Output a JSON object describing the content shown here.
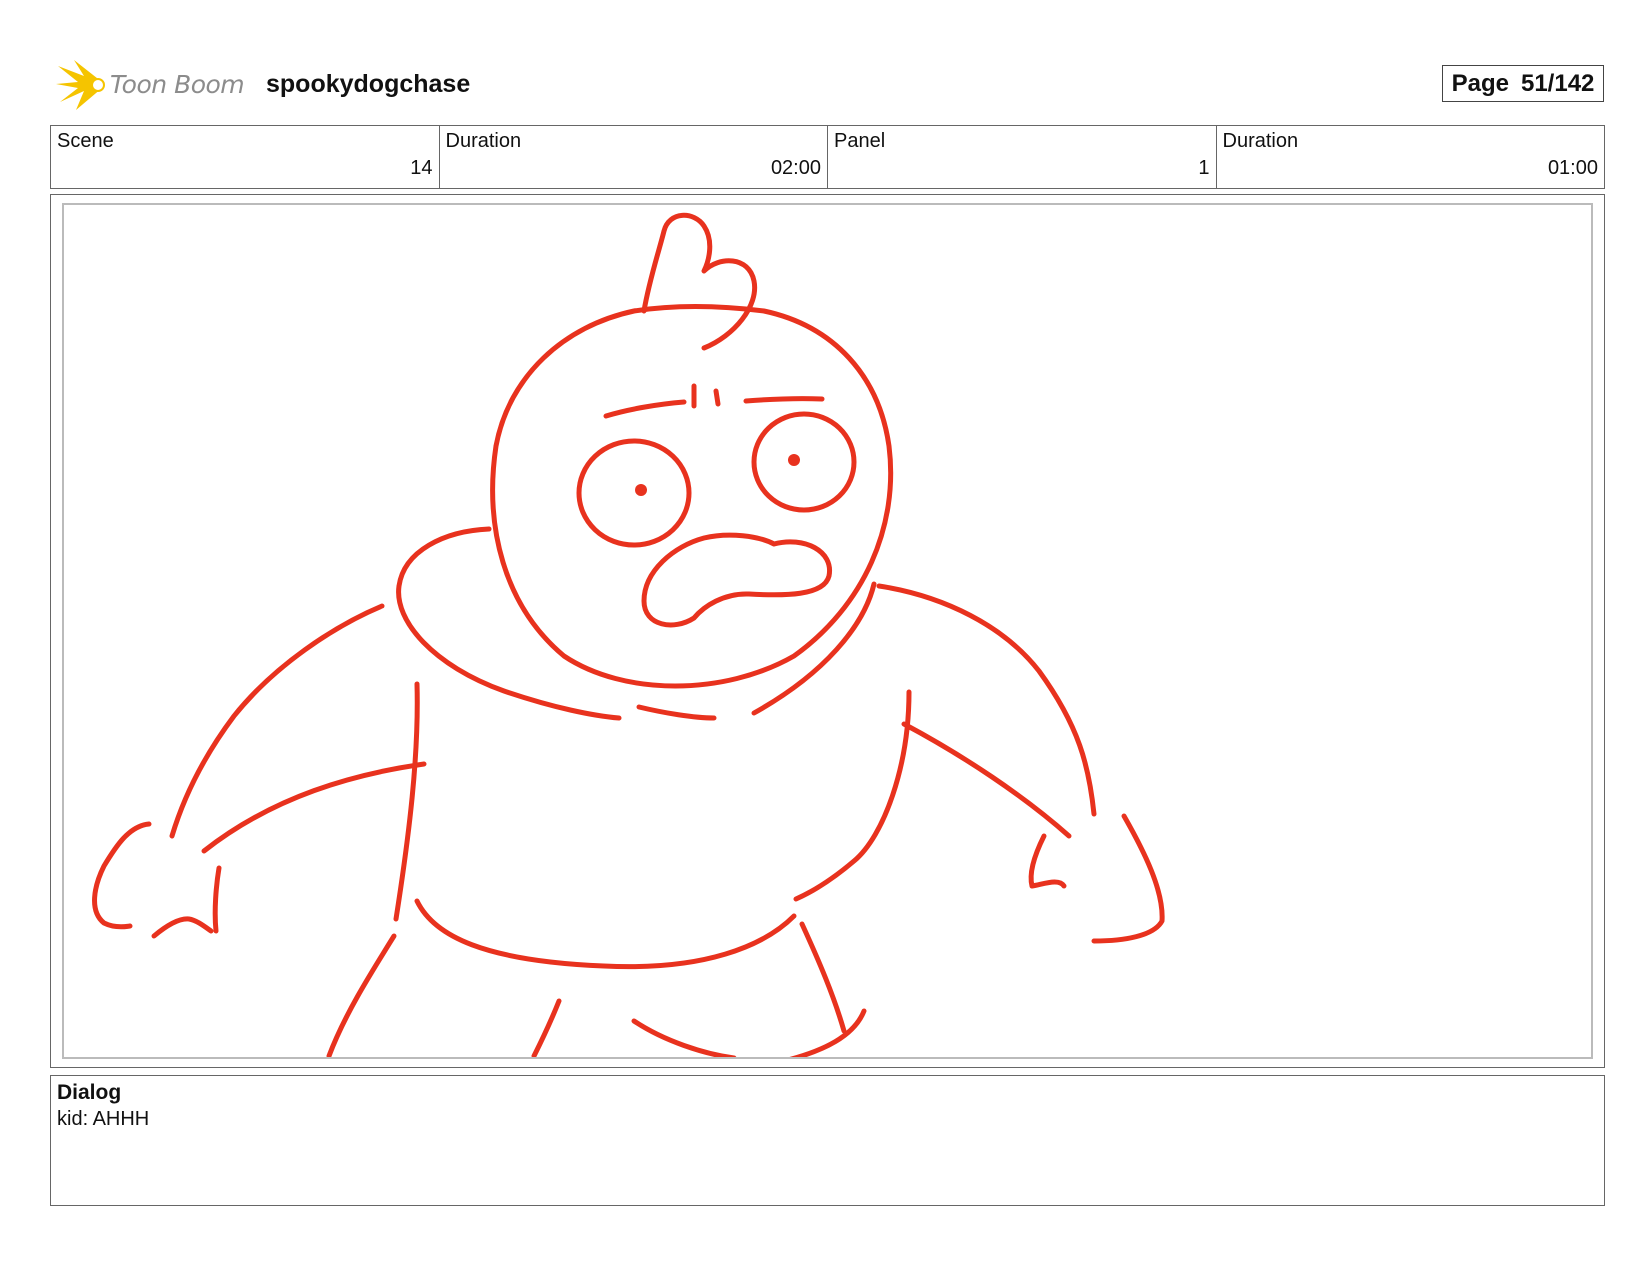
{
  "header": {
    "logo_text": "Toon Boom",
    "project_title": "spookydogchase",
    "page_label": "Page",
    "page_value": "51/142"
  },
  "info": [
    {
      "label": "Scene",
      "value": "14"
    },
    {
      "label": "Duration",
      "value": "02:00"
    },
    {
      "label": "Panel",
      "value": "1"
    },
    {
      "label": "Duration",
      "value": "01:00"
    }
  ],
  "panel": {
    "sketch_color": "#e8321e",
    "border_color": "#bbbbbb"
  },
  "dialog": {
    "title": "Dialog",
    "text": "kid: AHHH"
  }
}
